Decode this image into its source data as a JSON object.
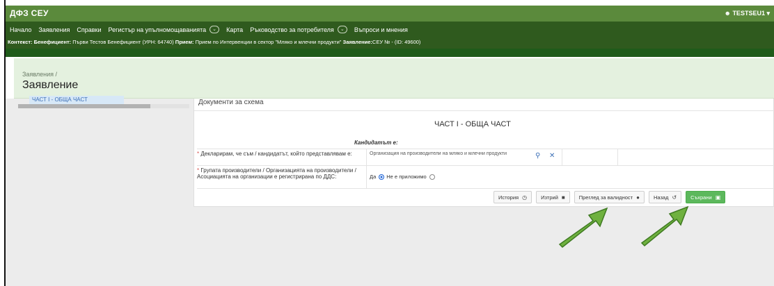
{
  "app": {
    "brand": "ДФЗ СЕУ",
    "user": "TESTSEU1"
  },
  "nav": [
    {
      "label": "Начало",
      "dropdown": false
    },
    {
      "label": "Заявления",
      "dropdown": false
    },
    {
      "label": "Справки",
      "dropdown": false
    },
    {
      "label": "Регистър на упълномощаванията",
      "dropdown": true
    },
    {
      "label": "Карта",
      "dropdown": false
    },
    {
      "label": "Ръководство за потребителя",
      "dropdown": true
    },
    {
      "label": "Въпроси и мнения",
      "dropdown": false
    }
  ],
  "context": {
    "k1": "Контекст:",
    "v1": "Бенефициент:",
    "v1b": " Първи Тестов Бенефициент (УРН: 64740) ",
    "k2": "Прием:",
    "v2": " Прием по Интервенции в сектор \"Мляко и млечни продукти\" ",
    "k3": "Заявление:",
    "v3": "СЕУ № - (ID: 49600)"
  },
  "header": {
    "breadcrumb": "Заявления /",
    "title": "Заявление"
  },
  "tree": {
    "item": "ЧАСТ I - ОБЩА ЧАСТ"
  },
  "card": {
    "title": "Документи за схема",
    "section_title": "ЧАСТ I - ОБЩА ЧАСТ",
    "candidate_label": "Кандидатът е:"
  },
  "fields": {
    "q1": "Декларирам, че съм / кандидатът, който представлявам е:",
    "q1_value": "Организация на производители на мляко и млечни продукти",
    "q2": "Групата производители / Организацията на производители / Асоциацията на организации е регистрирана по ДДС:",
    "q2_yes": "Да",
    "q2_na": "Не е приложимо",
    "q2_selected": "Да"
  },
  "buttons": {
    "history": "История",
    "delete": "Изтрий",
    "validate": "Преглед за валидност",
    "back": "Назад",
    "save": "Съхрани"
  },
  "colors": {
    "topbar": "#5b8a3c",
    "navbar": "#2f5a1e",
    "header_bg": "#e4f1df",
    "save": "#5cb85c",
    "arrow": "#6fb13f"
  },
  "icons": {
    "user": "user-icon",
    "search": "search-icon",
    "clear": "close-icon",
    "history": "history-icon",
    "delete": "trash-icon",
    "validate": "check-circle-icon",
    "back": "undo-icon",
    "save": "save-icon"
  }
}
